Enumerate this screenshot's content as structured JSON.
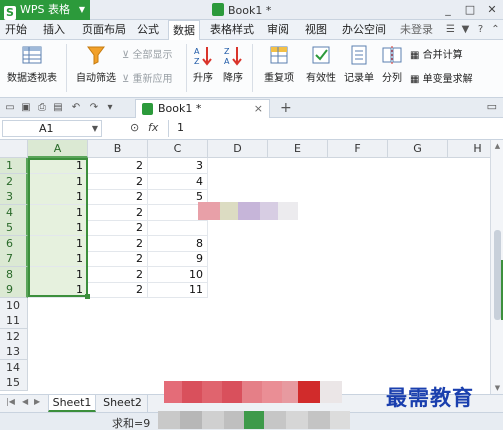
{
  "app": {
    "name": "WPS 表格",
    "logo_letter": "S",
    "doc_title": "Book1 *"
  },
  "window_controls": [
    "_",
    "□",
    "✕"
  ],
  "menu": {
    "tabs": [
      "开始",
      "插入",
      "页面布局",
      "公式",
      "数据",
      "表格样式",
      "审阅",
      "视图",
      "办公空间"
    ],
    "active": "数据",
    "login": "未登录"
  },
  "ribbon": {
    "pivot": "数据透视表",
    "autofilter": "自动筛选",
    "show_all": "全部显示",
    "reapply": "重新应用",
    "sort_asc": "升序",
    "sort_desc": "降序",
    "duplicates": "重复项",
    "validity": "有效性",
    "form": "记录单",
    "split": "分列",
    "consolidate": "合并计算",
    "simulate": "单变量求解"
  },
  "doc_tab": {
    "label": "Book1 *",
    "close": "×",
    "new": "+"
  },
  "formula_bar": {
    "cell_ref": "A1",
    "fx": "fx",
    "value": "1"
  },
  "columns": [
    "A",
    "B",
    "C",
    "D",
    "E",
    "F",
    "G",
    "H"
  ],
  "rows": [
    "1",
    "2",
    "3",
    "4",
    "5",
    "6",
    "7",
    "8",
    "9",
    "10",
    "11",
    "12",
    "13",
    "14",
    "15"
  ],
  "cells": {
    "A": [
      "1",
      "1",
      "1",
      "1",
      "1",
      "1",
      "1",
      "1",
      "1"
    ],
    "B": [
      "2",
      "2",
      "2",
      "2",
      "2",
      "2",
      "2",
      "2",
      "2"
    ],
    "C": [
      "3",
      "4",
      "5",
      "",
      "",
      "8",
      "9",
      "10",
      "11"
    ]
  },
  "sheets": [
    "Sheet1",
    "Sheet2"
  ],
  "active_sheet": "Sheet1",
  "status": {
    "sum": "求和=9"
  },
  "watermark": "最需教育",
  "colors": {
    "accent_green": "#2c9a3b",
    "selection": "#3c8f3c"
  }
}
